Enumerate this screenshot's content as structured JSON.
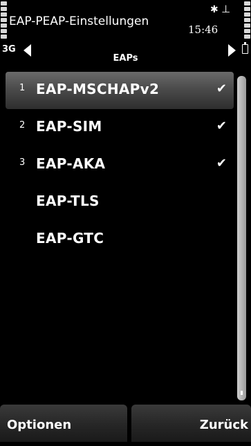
{
  "status": {
    "title": "EAP-PEAP-Einstellungen",
    "time": "15:46",
    "network_mode": "3G",
    "bluetooth_icon": "bluetooth-icon",
    "network_icon": "antenna-icon"
  },
  "tab": {
    "title": "EAPs"
  },
  "list": {
    "items": [
      {
        "number": "1",
        "label": "EAP-MSCHAPv2",
        "checked": true,
        "selected": true
      },
      {
        "number": "2",
        "label": "EAP-SIM",
        "checked": true,
        "selected": false
      },
      {
        "number": "3",
        "label": "EAP-AKA",
        "checked": true,
        "selected": false
      },
      {
        "number": "",
        "label": "EAP-TLS",
        "checked": false,
        "selected": false
      },
      {
        "number": "",
        "label": "EAP-GTC",
        "checked": false,
        "selected": false
      }
    ]
  },
  "softkeys": {
    "left": "Optionen",
    "right": "Zurück"
  },
  "colors": {
    "background": "#000000",
    "highlight": "#5a5a5a",
    "text": "#ffffff"
  }
}
